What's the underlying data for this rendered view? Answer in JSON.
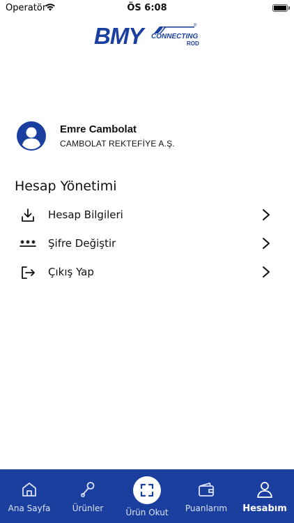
{
  "status_bar": {
    "carrier": "Operatör",
    "time": "ÖS 6:08"
  },
  "logo": {
    "brand": "BMY",
    "line1": "CONNECTING",
    "line2": "ROD",
    "registered": "®"
  },
  "profile": {
    "name": "Emre Cambolat",
    "company": "CAMBOLAT REKTEFİYE A.Ş."
  },
  "account_section": {
    "title": "Hesap Yönetimi",
    "items": [
      {
        "label": "Hesap Bilgileri",
        "icon": "download-icon"
      },
      {
        "label": "Şifre Değiştir",
        "icon": "password-icon"
      },
      {
        "label": "Çıkış Yap",
        "icon": "logout-icon"
      }
    ]
  },
  "bottom_nav": {
    "items": [
      {
        "label": "Ana Sayfa",
        "icon": "home-icon"
      },
      {
        "label": "Ürünler",
        "icon": "wrench-icon"
      },
      {
        "label": "Ürün Okut",
        "icon": "scan-icon"
      },
      {
        "label": "Puanlarım",
        "icon": "wallet-icon"
      },
      {
        "label": "Hesabım",
        "icon": "user-icon"
      }
    ],
    "active": "Hesabım"
  },
  "colors": {
    "brand": "#1a3f9e",
    "text": "#111111"
  }
}
